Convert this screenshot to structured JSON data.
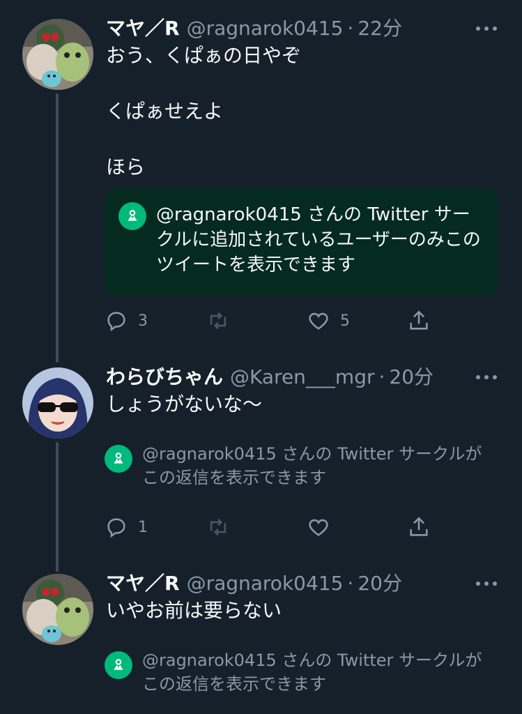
{
  "tweets": [
    {
      "name": "マヤ／R",
      "handle": "@ragnarok0415",
      "time": "22分",
      "text": "おう、くぱぁの日やぞ\n\nくぱぁせえよ\n\nほら",
      "circle_notice": "@ragnarok0415 さんの Twitter サークルに追加されているユーザーのみこのツイートを表示できます",
      "actions": {
        "reply_count": "3",
        "retweet_count": "",
        "like_count": "5"
      }
    },
    {
      "name": "わらびちゃん",
      "handle": "@Karen___mgr",
      "time": "20分",
      "text": "しょうがないな〜",
      "circle_notice": "@ragnarok0415 さんの Twitter サークルがこの返信を表示できます",
      "actions": {
        "reply_count": "1",
        "retweet_count": "",
        "like_count": ""
      }
    },
    {
      "name": "マヤ／R",
      "handle": "@ragnarok0415",
      "time": "20分",
      "text": "いやお前は要らない",
      "circle_notice": "@ragnarok0415 さんの Twitter サークルがこの返信を表示できます"
    }
  ],
  "separator": "·",
  "colors": {
    "background": "#15202b",
    "text": "#f7f9f9",
    "muted": "#8b98a5",
    "circle_green": "#00ba7c",
    "circle_box": "#052a1f",
    "thread_line": "#3d4c5c"
  },
  "icons": [
    "more-icon",
    "reply-icon",
    "retweet-icon",
    "like-icon",
    "share-icon",
    "circle-icon"
  ]
}
